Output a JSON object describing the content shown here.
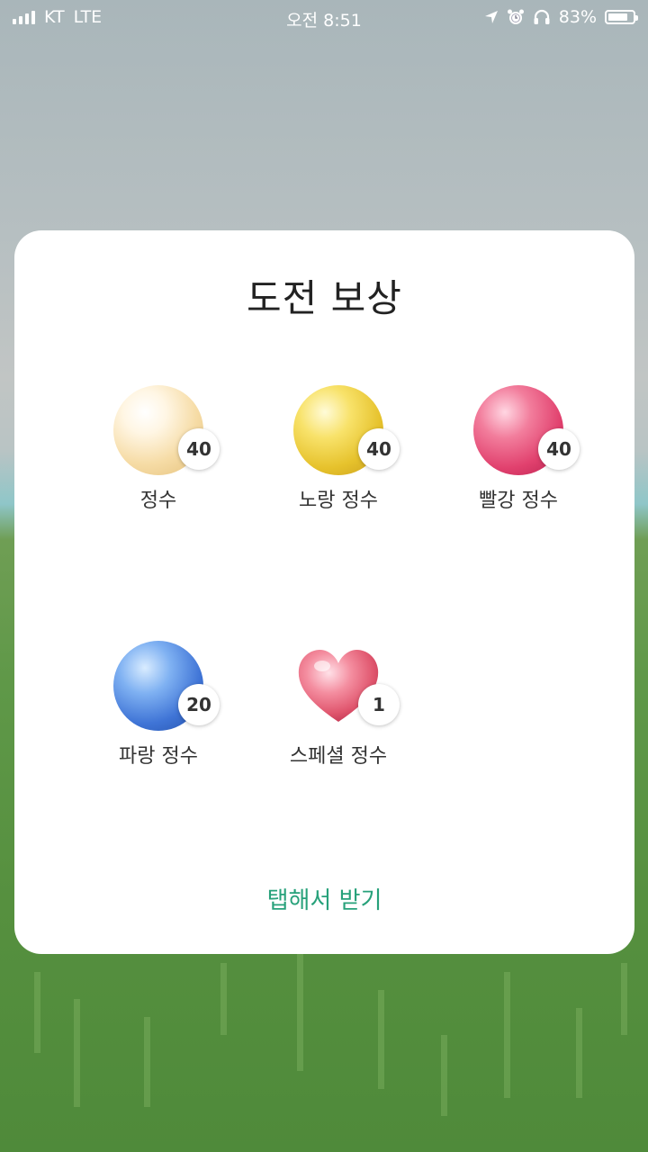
{
  "status_bar": {
    "carrier": "KT",
    "network": "LTE",
    "time": "오전 8:51",
    "battery_pct": "83%",
    "battery_level": 0.83
  },
  "modal": {
    "title": "도전 보상",
    "rewards": [
      {
        "name": "정수",
        "count": "40",
        "color": "#f3d79a"
      },
      {
        "name": "노랑 정수",
        "count": "40",
        "color": "#e8c12e"
      },
      {
        "name": "빨강 정수",
        "count": "40",
        "color": "#e2456f"
      },
      {
        "name": "파랑 정수",
        "count": "20",
        "color": "#3e76d6"
      },
      {
        "name": "스페셜 정수",
        "count": "1",
        "color": "#e86a80"
      }
    ],
    "cta": "탭해서 받기"
  },
  "accent_color": "#27a17a"
}
